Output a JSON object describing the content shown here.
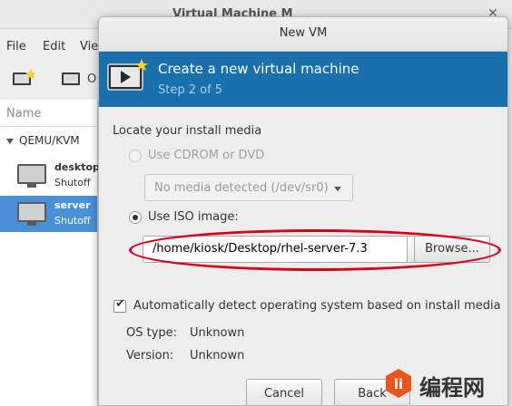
{
  "background_window": {
    "title": "Virtual Machine M",
    "menu": [
      "File",
      "Edit",
      "Vie"
    ],
    "toolbar_open_label": "O",
    "list_header": "Name",
    "group": "QEMU/KVM",
    "vms": [
      {
        "name": "desktop",
        "state": "Shutoff",
        "selected": false
      },
      {
        "name": "server",
        "state": "Shutoff",
        "selected": true
      }
    ]
  },
  "dialog": {
    "title": "New VM",
    "banner_title": "Create a new virtual machine",
    "banner_step": "Step 2 of 5",
    "locate_label": "Locate your install media",
    "cdrom_option": "Use CDROM or DVD",
    "cdrom_combo_value": "No media detected (/dev/sr0)",
    "iso_option": "Use ISO image:",
    "iso_path": "/home/kiosk/Desktop/rhel-server-7.3",
    "browse_label": "Browse...",
    "auto_detect_label": "Automatically detect operating system based on install media",
    "auto_detect_checked": true,
    "os_type_label": "OS type:",
    "os_type_value": "Unknown",
    "version_label": "Version:",
    "version_value": "Unknown",
    "cancel_label": "Cancel",
    "back_label": "Back"
  },
  "watermark": {
    "text": "编程网",
    "logo_text": "li"
  },
  "colors": {
    "banner": "#1a6fad",
    "selection": "#4a90d9",
    "annotation": "#d9001b"
  }
}
